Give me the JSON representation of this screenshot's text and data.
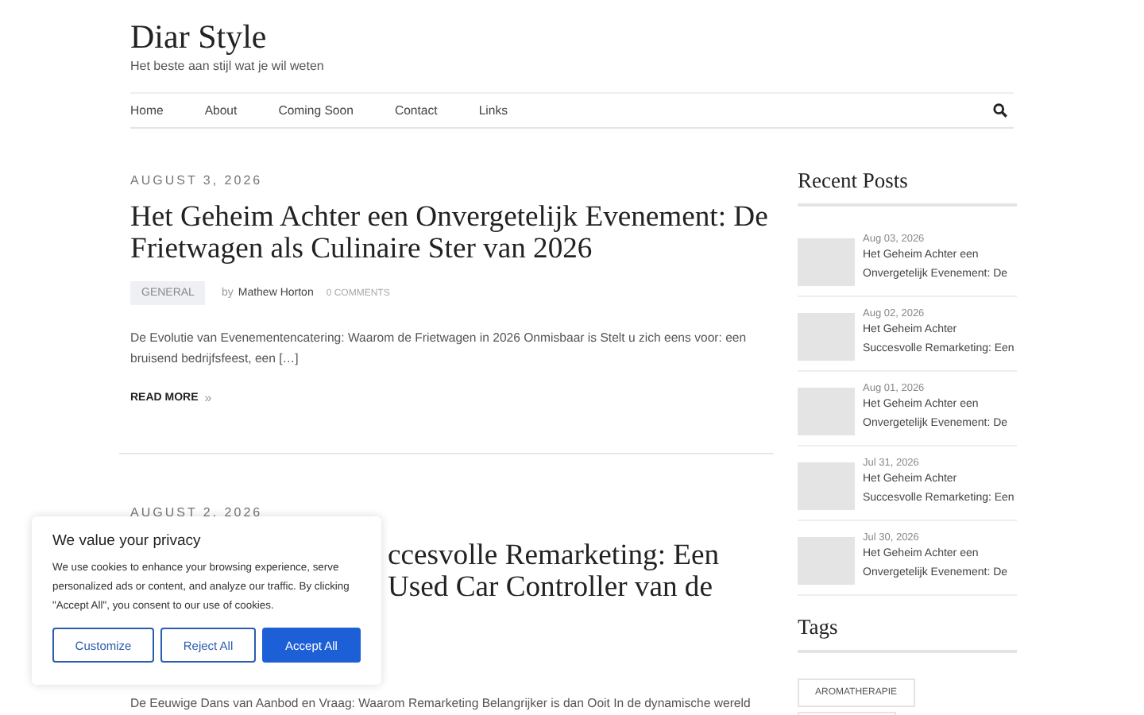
{
  "site": {
    "title": "Diar Style",
    "tagline": "Het beste aan stijl wat je wil weten"
  },
  "nav": {
    "items": [
      {
        "label": "Home"
      },
      {
        "label": "About"
      },
      {
        "label": "Coming Soon"
      },
      {
        "label": "Contact"
      },
      {
        "label": "Links"
      }
    ]
  },
  "posts": [
    {
      "date": "AUGUST 3, 2026",
      "title_lines": [
        "Het Geheim Achter een Onvergetelijk Evenement: De",
        "Frietwagen als Culinaire Ster van 2026"
      ],
      "title_offset": false,
      "category": "GENERAL",
      "by": "by",
      "author": "Mathew Horton",
      "comments": "0 COMMENTS",
      "excerpt": "De Evolutie van Evenementencatering: Waarom de Frietwagen in 2026 Onmisbaar is Stelt u zich eens voor: een bruisend bedrijfsfeest, een […]",
      "read_more": "READ MORE",
      "read_more_icon": "»"
    },
    {
      "date": "AUGUST 2, 2026",
      "title_lines": [
        "ccesvolle Remarketing: Een",
        "Used Car Controller van de"
      ],
      "title_offset": true,
      "excerpt": "De Eeuwige Dans van Aanbod en Vraag: Waarom Remarketing Belangrijker is dan Ooit In de dynamische wereld"
    }
  ],
  "sidebar": {
    "recent_title": "Recent Posts",
    "recent": [
      {
        "date": "Aug 03, 2026",
        "title_lines": [
          "Het Geheim Achter een",
          "Onvergetelijk Evenement: De"
        ]
      },
      {
        "date": "Aug 02, 2026",
        "title_lines": [
          "Het Geheim Achter",
          "Succesvolle Remarketing: Een"
        ]
      },
      {
        "date": "Aug 01, 2026",
        "title_lines": [
          "Het Geheim Achter een",
          "Onvergetelijk Evenement: De"
        ]
      },
      {
        "date": "Jul 31, 2026",
        "title_lines": [
          "Het Geheim Achter",
          "Succesvolle Remarketing: Een"
        ]
      },
      {
        "date": "Jul 30, 2026",
        "title_lines": [
          "Het Geheim Achter een",
          "Onvergetelijk Evenement: De"
        ]
      }
    ],
    "tags_title": "Tags",
    "tags": [
      {
        "label": "AROMATHERAPIE"
      }
    ]
  },
  "cookie": {
    "title": "We value your privacy",
    "text": "We use cookies to enhance your browsing experience, serve personalized ads or content, and analyze our traffic. By clicking \"Accept All\", you consent to our use of cookies.",
    "buttons": [
      {
        "label": "Customize",
        "kind": "outline"
      },
      {
        "label": "Reject All",
        "kind": "outline"
      },
      {
        "label": "Accept All",
        "kind": "primary"
      }
    ]
  }
}
